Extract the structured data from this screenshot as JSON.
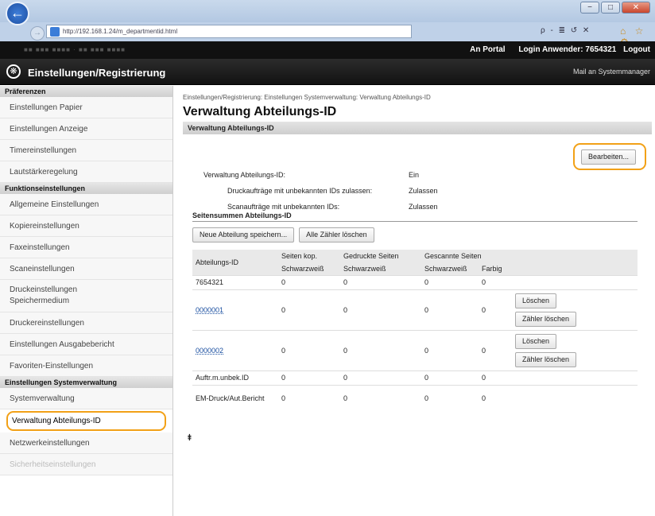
{
  "browser": {
    "url": "http://192.168.1.24/m_departmentid.html",
    "search_ctl": "ρ - ≣ ↺ ✕",
    "right_icons": "⌂ ☆ ⚙"
  },
  "window_controls": {
    "minimize": "−",
    "maximize": "□",
    "close": "✕"
  },
  "topnav": {
    "device_name": "■■ ■■■ ■■■■ · ■■ ■■■ ■■■■",
    "portal": "An Portal",
    "login_label": "Login Anwender: 7654321",
    "logout": "Logout"
  },
  "header": {
    "title": "Einstellungen/Registrierung",
    "mail": "Mail an Systemmanager"
  },
  "sidebar": {
    "preferences_head": "Präferenzen",
    "preferences": [
      "Einstellungen Papier",
      "Einstellungen Anzeige",
      "Timereinstellungen",
      "Lautstärkeregelung"
    ],
    "functions_head": "Funktionseinstellungen",
    "functions": [
      "Allgemeine Einstellungen",
      "Kopiereinstellungen",
      "Faxeinstellungen",
      "Scaneinstellungen",
      "Druckeinstellungen Speichermedium",
      "Druckereinstellungen",
      "Einstellungen Ausgabebericht",
      "Favoriten-Einstellungen"
    ],
    "sysadmin_head": "Einstellungen Systemverwaltung",
    "sysadmin": [
      "Systemverwaltung",
      "Verwaltung Abteilungs-ID",
      "Netzwerkeinstellungen",
      "Sicherheitseinstellungen"
    ]
  },
  "main": {
    "breadcrumb": "Einstellungen/Registrierung: Einstellungen Systemverwaltung: Verwaltung Abteilungs-ID",
    "title": "Verwaltung Abteilungs-ID",
    "section_bar": "Verwaltung Abteilungs-ID",
    "edit_button": "Bearbeiten...",
    "settings": {
      "dept_label": "Verwaltung Abteilungs-ID:",
      "dept_value": "Ein",
      "print_label": "Druckaufträge mit unbekannten IDs zulassen:",
      "print_value": "Zulassen",
      "scan_label": "Scanaufträge mit unbekannten IDs:",
      "scan_value": "Zulassen"
    },
    "subsection": "Seitensummen Abteilungs-ID",
    "new_button": "Neue Abteilung speichern...",
    "clear_all_button": "Alle Zähler löschen",
    "table": {
      "h_id": "Abteilungs-ID",
      "h_copy": "Seiten kop.",
      "h_printed": "Gedruckte Seiten",
      "h_scanned": "Gescannte Seiten",
      "sub_bw1": "Schwarzweiß",
      "sub_bw2": "Schwarzweiß",
      "sub_bw3": "Schwarzweiß",
      "sub_color": "Farbig",
      "rows": [
        {
          "id": "7654321",
          "c": "0",
          "p": "0",
          "s": "0",
          "f": "0"
        },
        {
          "id": "0000001",
          "c": "0",
          "p": "0",
          "s": "0",
          "f": "0",
          "del": "Löschen",
          "clr": "Zähler löschen"
        },
        {
          "id": "0000002",
          "c": "0",
          "p": "0",
          "s": "0",
          "f": "0",
          "del": "Löschen",
          "clr": "Zähler löschen"
        },
        {
          "id": "Auftr.m.unbek.ID",
          "c": "0",
          "p": "0",
          "s": "0",
          "f": "0"
        },
        {
          "id": "EM-Druck/Aut.Bericht",
          "c": "0",
          "p": "0",
          "s": "0",
          "f": "0"
        }
      ]
    },
    "to_top": "⯒"
  }
}
